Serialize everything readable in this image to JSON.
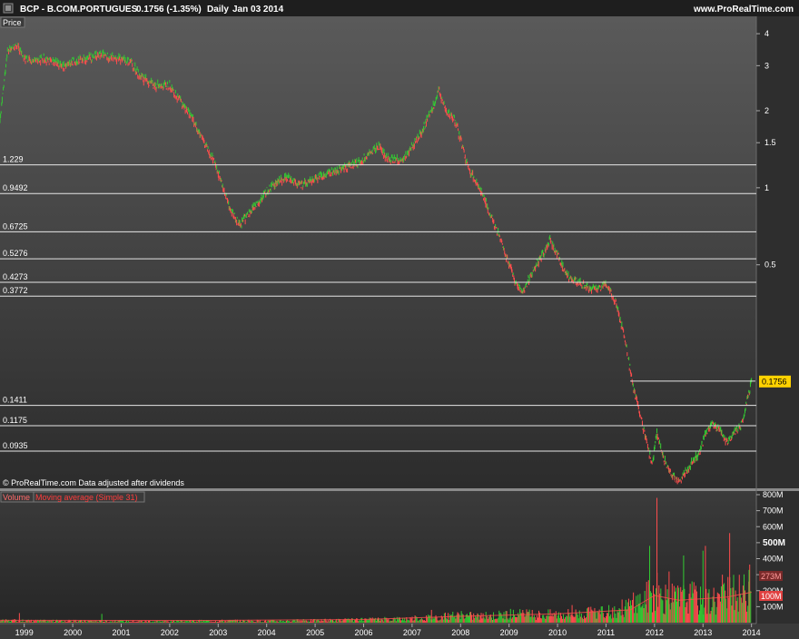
{
  "header": {
    "title": "BCP - B.COM.PORTUGUES",
    "last": "0.1756 (-1.35%)",
    "timeframe": "Daily",
    "date": "Jan 03 2014",
    "site": "www.ProRealTime.com"
  },
  "price_panel": {
    "label": "Price",
    "footer": "© ProRealTime.com  Data adjusted after dividends",
    "current_value_tag": "0.1756"
  },
  "volume_panel": {
    "label_volume": "Volume",
    "label_ma": "Moving average (Simple 31)",
    "tag_ma": "273M",
    "tag_vol": "100M"
  },
  "colors": {
    "background_top": "#5a5a5a",
    "background_bottom": "#2a2a2a",
    "up": "#33cc33",
    "down": "#ff4d4d",
    "level_line": "#e6e6e6",
    "current_tag": "#ffd200",
    "ma_label": "#ff3b3b"
  },
  "chart_data": [
    {
      "type": "line",
      "title": "BCP - B.COM.PORTUGUES",
      "ylabel": "Price",
      "y_scale": "log",
      "ylim": [
        0.068,
        4.6
      ],
      "y_ticks": [
        "4",
        "3",
        "2",
        "1.5",
        "1",
        "0.5"
      ],
      "x_ticks": [
        "1999",
        "2000",
        "2001",
        "2002",
        "2003",
        "2004",
        "2005",
        "2006",
        "2007",
        "2008",
        "2009",
        "2010",
        "2011",
        "2012",
        "2013",
        "2014"
      ],
      "xlim": [
        1998.5,
        2014.1
      ],
      "levels": [
        {
          "label": "1.229",
          "value": 1.229
        },
        {
          "label": "0.9492",
          "value": 0.9492
        },
        {
          "label": "0.6725",
          "value": 0.6725
        },
        {
          "label": "0.5276",
          "value": 0.5276
        },
        {
          "label": "0.4273",
          "value": 0.4273
        },
        {
          "label": "0.3772",
          "value": 0.3772
        },
        {
          "label": "0.1411",
          "value": 0.1411
        },
        {
          "label": "0.1175",
          "value": 0.1175
        },
        {
          "label": "0.0935",
          "value": 0.0935
        }
      ],
      "recent_level": {
        "value": 0.1756,
        "from": 2011.5
      },
      "series": [
        {
          "x": [
            1998.5,
            1998.65,
            1998.85,
            1999.0,
            1999.2,
            1999.4,
            1999.6,
            1999.8,
            2000.0,
            2000.3,
            2000.6,
            2000.9,
            2001.2,
            2001.4,
            2001.7,
            2002.0,
            2002.2,
            2002.45,
            2002.7,
            2002.9,
            2003.1,
            2003.25,
            2003.45,
            2003.7,
            2004.0,
            2004.2,
            2004.4,
            2004.7,
            2005.0,
            2005.3,
            2005.6,
            2005.9,
            2006.1,
            2006.3,
            2006.5,
            2006.8,
            2007.0,
            2007.2,
            2007.4,
            2007.55,
            2007.7,
            2007.9,
            2008.1,
            2008.2,
            2008.4,
            2008.6,
            2008.8,
            2009.0,
            2009.15,
            2009.3,
            2009.5,
            2009.7,
            2009.85,
            2010.0,
            2010.2,
            2010.4,
            2010.6,
            2010.8,
            2011.0,
            2011.2,
            2011.4,
            2011.55,
            2011.7,
            2011.85,
            2011.95,
            2012.05,
            2012.2,
            2012.35,
            2012.5,
            2012.65,
            2012.8,
            2012.95,
            2013.05,
            2013.2,
            2013.35,
            2013.5,
            2013.65,
            2013.8,
            2013.92,
            2014.0
          ],
          "y": [
            1.8,
            3.4,
            3.6,
            3.2,
            3.1,
            3.2,
            3.1,
            3.0,
            3.1,
            3.2,
            3.3,
            3.2,
            3.1,
            2.7,
            2.5,
            2.5,
            2.2,
            1.9,
            1.5,
            1.3,
            1.0,
            0.82,
            0.72,
            0.82,
            0.97,
            1.05,
            1.1,
            1.02,
            1.08,
            1.15,
            1.2,
            1.25,
            1.35,
            1.45,
            1.3,
            1.28,
            1.45,
            1.65,
            2.0,
            2.4,
            2.0,
            1.8,
            1.3,
            1.15,
            1.0,
            0.8,
            0.65,
            0.5,
            0.42,
            0.39,
            0.48,
            0.55,
            0.62,
            0.55,
            0.45,
            0.43,
            0.41,
            0.4,
            0.42,
            0.36,
            0.25,
            0.17,
            0.13,
            0.1,
            0.082,
            0.11,
            0.086,
            0.076,
            0.07,
            0.078,
            0.086,
            0.094,
            0.11,
            0.12,
            0.112,
            0.1,
            0.11,
            0.12,
            0.15,
            0.1756
          ]
        }
      ]
    },
    {
      "type": "bar",
      "title": "Volume",
      "series_names": [
        "Volume",
        "Moving average (Simple 31)"
      ],
      "ylim": [
        0,
        800
      ],
      "y_ticks": [
        "800M",
        "700M",
        "600M",
        "500M",
        "400M",
        "300M",
        "200M",
        "100M"
      ],
      "volume_m": {
        "x": [
          1998.5,
          2000.0,
          2002.0,
          2003.0,
          2004.0,
          2005.0,
          2006.0,
          2007.0,
          2007.5,
          2008.0,
          2008.5,
          2009.0,
          2009.5,
          2010.0,
          2010.5,
          2011.0,
          2011.5,
          2011.8,
          2012.0,
          2012.2,
          2012.5,
          2012.8,
          2013.0,
          2013.3,
          2013.6,
          2013.9,
          2014.0
        ],
        "y": [
          15,
          12,
          10,
          14,
          12,
          16,
          20,
          30,
          40,
          50,
          45,
          60,
          55,
          60,
          65,
          70,
          120,
          170,
          230,
          160,
          170,
          180,
          150,
          170,
          200,
          220,
          260
        ]
      },
      "spikes_m": [
        {
          "x": 1998.9,
          "y": 60
        },
        {
          "x": 2000.6,
          "y": 55
        },
        {
          "x": 2007.4,
          "y": 80
        },
        {
          "x": 2010.3,
          "y": 110
        },
        {
          "x": 2011.9,
          "y": 480
        },
        {
          "x": 2012.05,
          "y": 780
        },
        {
          "x": 2012.3,
          "y": 320
        },
        {
          "x": 2012.6,
          "y": 420
        },
        {
          "x": 2013.0,
          "y": 450
        },
        {
          "x": 2013.05,
          "y": 480
        },
        {
          "x": 2013.4,
          "y": 300
        },
        {
          "x": 2013.55,
          "y": 560
        },
        {
          "x": 2013.95,
          "y": 330
        }
      ],
      "moving_average_m": {
        "x": [
          1998.5,
          2003.0,
          2006.0,
          2008.0,
          2010.0,
          2011.5,
          2012.0,
          2012.5,
          2013.0,
          2013.5,
          2014.0
        ],
        "y": [
          15,
          14,
          20,
          40,
          55,
          80,
          170,
          140,
          150,
          160,
          190
        ]
      }
    }
  ]
}
